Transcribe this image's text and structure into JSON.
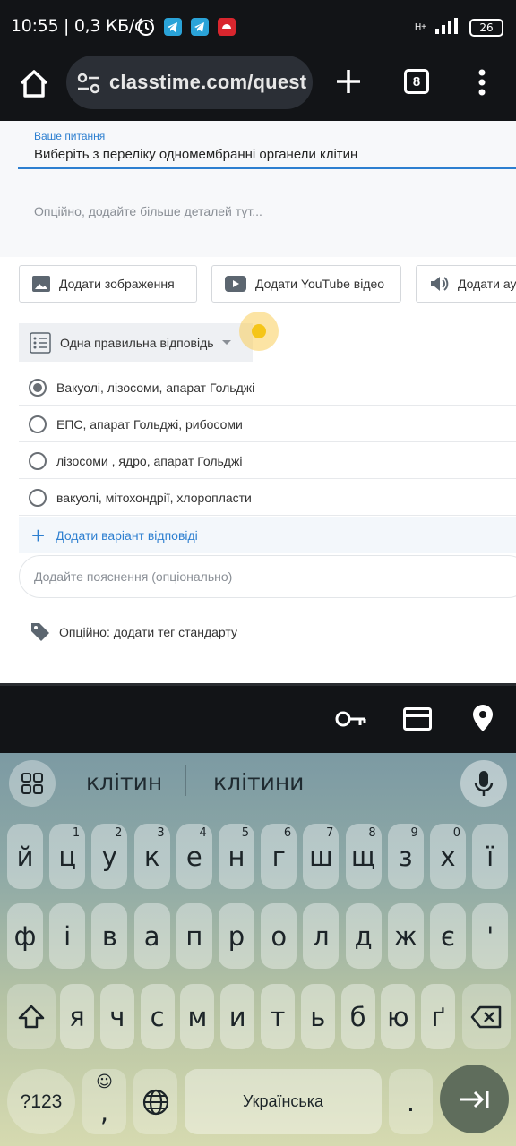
{
  "status_bar": {
    "time": "10:55",
    "speed": "0,3 КБ/с",
    "network": "H+",
    "battery": "26"
  },
  "browser": {
    "url": "classtime.com/quest",
    "tab_count": "8"
  },
  "question": {
    "label": "Ваше питання",
    "text": "Виберіть з переліку одномембранні органели клітин",
    "details_placeholder": "Опційно, додайте більше деталей тут..."
  },
  "media_buttons": {
    "image": "Додати зображення",
    "youtube": "Додати YouTube відео",
    "audio": "Додати ау"
  },
  "question_type": "Одна правильна відповідь",
  "answers": [
    {
      "text": "Вакуолі, лізосоми, апарат Гольджі",
      "selected": true
    },
    {
      "text": "ЕПС, апарат Гольджі, рибосоми",
      "selected": false
    },
    {
      "text": "лізосоми , ядро, апарат Гольджі",
      "selected": false
    },
    {
      "text": "вакуолі, мітохондрії, хлоропласти",
      "selected": false
    }
  ],
  "add_answer_label": "Додати варіант відповіді",
  "explanation_placeholder": "Додайте пояснення (опціонально)",
  "tag_label": "Опційно: додати тег стандарту",
  "keyboard": {
    "suggestions": [
      "клітин",
      "клітини"
    ],
    "row1": [
      "й",
      "ц",
      "у",
      "к",
      "е",
      "н",
      "г",
      "ш",
      "щ",
      "з",
      "х",
      "ї"
    ],
    "row1_hints": [
      "",
      "1",
      "2",
      "3",
      "4",
      "5",
      "6",
      "7",
      "8",
      "9",
      "0",
      ""
    ],
    "row2": [
      "ф",
      "і",
      "в",
      "а",
      "п",
      "р",
      "о",
      "л",
      "д",
      "ж",
      "є",
      "'"
    ],
    "row3": [
      "я",
      "ч",
      "с",
      "м",
      "и",
      "т",
      "ь",
      "б",
      "ю",
      "ґ"
    ],
    "symbols_key": "?123",
    "comma_key": ",",
    "space_label": "Українська",
    "period_key": "."
  }
}
